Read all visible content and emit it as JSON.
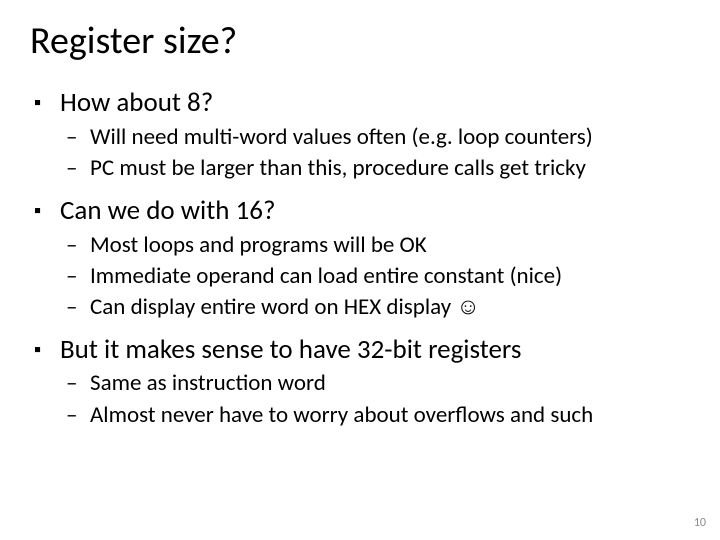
{
  "title": "Register size?",
  "bullets": [
    {
      "text": "How about 8?",
      "sub": [
        "Will need multi-word values often (e.g. loop counters)",
        "PC must be larger than this, procedure calls get tricky"
      ]
    },
    {
      "text": "Can we do with 16?",
      "sub": [
        "Most loops and programs will be OK",
        "Immediate operand can load entire constant (nice)",
        "Can display entire word on HEX display ☺"
      ]
    },
    {
      "text": "But it makes sense to have 32-bit registers",
      "sub": [
        "Same as instruction word",
        "Almost never have to worry about overflows and such"
      ]
    }
  ],
  "page_number": "10"
}
